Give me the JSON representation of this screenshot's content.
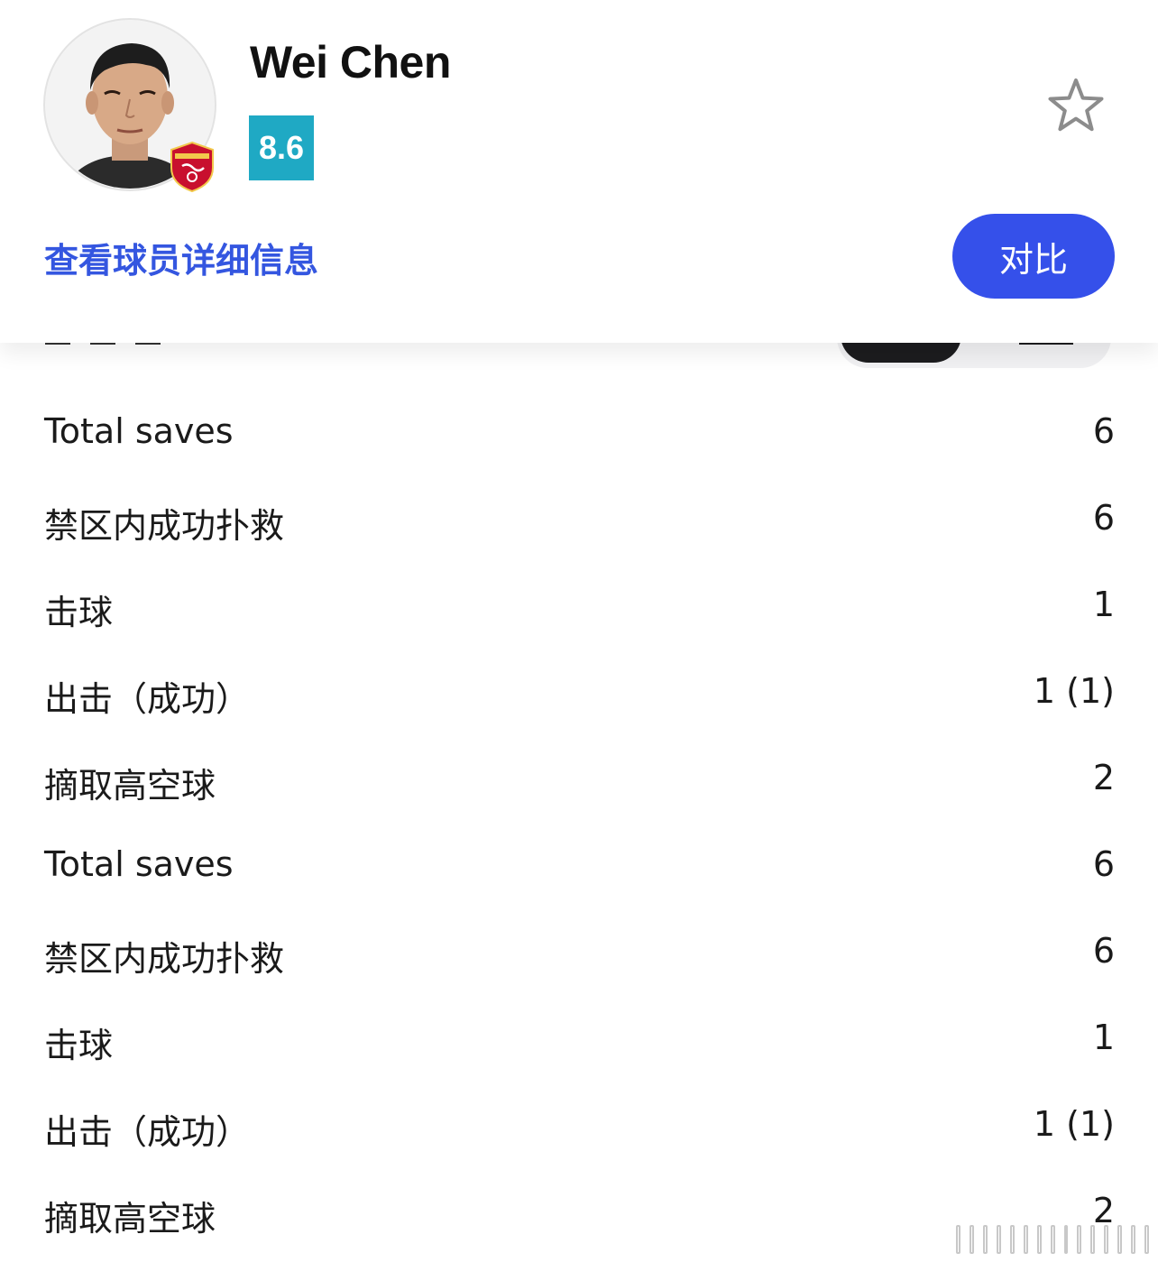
{
  "player": {
    "name": "Wei Chen",
    "rating": "8.6",
    "rating_color": "#1fa9c4"
  },
  "actions": {
    "detail_link": "查看球员详细信息",
    "detail_link_color": "#3456e0",
    "compare_button": "对比",
    "compare_button_color": "#3550ea",
    "favorite_icon": "star-outline-icon"
  },
  "stats": [
    {
      "label": "Total saves",
      "value": "6"
    },
    {
      "label": "禁区内成功扑救",
      "value": "6"
    },
    {
      "label": "击球",
      "value": "1"
    },
    {
      "label": "出击（成功）",
      "value": "1 (1)"
    },
    {
      "label": "摘取高空球",
      "value": "2"
    },
    {
      "label": "Total saves",
      "value": "6"
    },
    {
      "label": "禁区内成功扑救",
      "value": "6"
    },
    {
      "label": "击球",
      "value": "1"
    },
    {
      "label": "出击（成功）",
      "value": "1 (1)"
    },
    {
      "label": "摘取高空球",
      "value": "2"
    }
  ]
}
